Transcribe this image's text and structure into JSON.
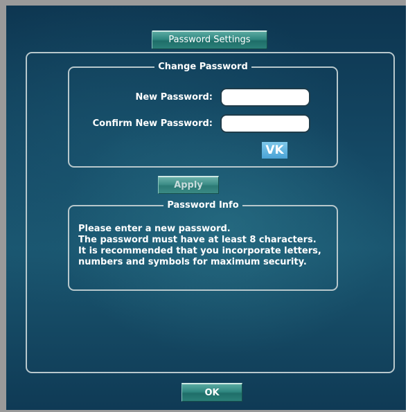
{
  "header": {
    "settings_button": "Password Settings"
  },
  "change_password": {
    "legend": "Change Password",
    "new_password_label": "New Password:",
    "new_password_value": "",
    "confirm_password_label": "Confirm New Password:",
    "confirm_password_value": "",
    "vk_button": "VK"
  },
  "apply_button": "Apply",
  "password_info": {
    "legend": "Password Info",
    "lines": [
      "Please enter a new password.",
      "The password must have at least 8 characters.",
      "It is recommended that you incorporate letters,",
      "numbers and symbols for maximum security."
    ]
  },
  "ok_button": "OK",
  "colors": {
    "button_teal": "#2f8780",
    "vk_blue": "#4aa3d6",
    "background_dark": "#0d3550",
    "border_light": "#b8c8cc"
  }
}
